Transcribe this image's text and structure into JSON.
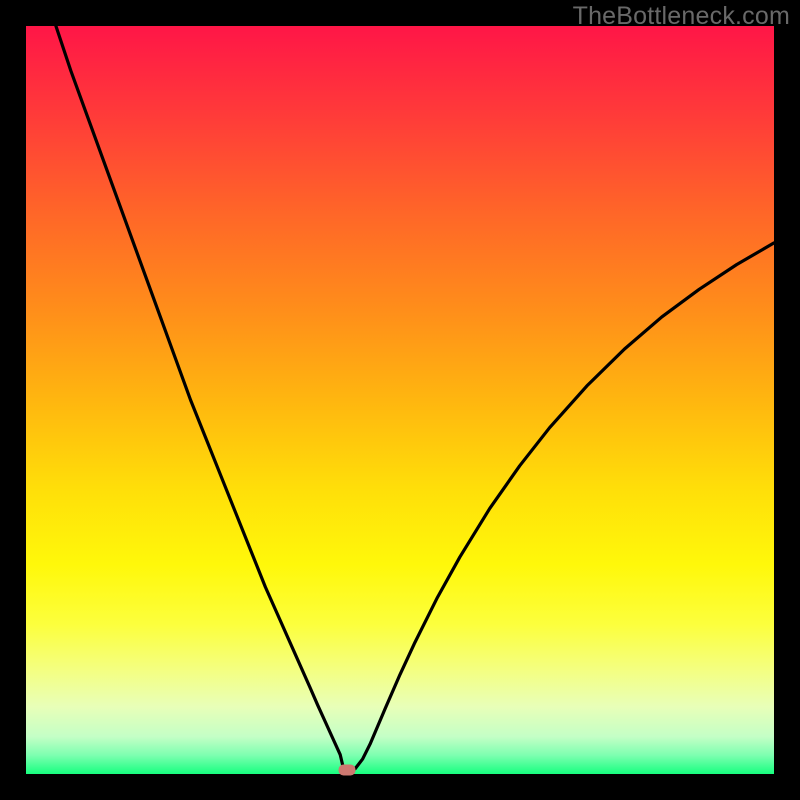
{
  "watermark": "TheBottleneck.com",
  "chart_data": {
    "type": "line",
    "title": "",
    "xlabel": "",
    "ylabel": "",
    "xlim": [
      0,
      100
    ],
    "ylim": [
      0,
      100
    ],
    "grid": false,
    "legend": false,
    "colors": {
      "gradient_stops": [
        {
          "pct": 0,
          "hex": "#ff1647"
        },
        {
          "pct": 12,
          "hex": "#ff3b39"
        },
        {
          "pct": 25,
          "hex": "#ff6628"
        },
        {
          "pct": 38,
          "hex": "#ff8e1a"
        },
        {
          "pct": 50,
          "hex": "#ffb60f"
        },
        {
          "pct": 62,
          "hex": "#ffdf09"
        },
        {
          "pct": 72,
          "hex": "#fff80a"
        },
        {
          "pct": 80,
          "hex": "#fcff3d"
        },
        {
          "pct": 86,
          "hex": "#f4ff80"
        },
        {
          "pct": 91,
          "hex": "#e8ffb8"
        },
        {
          "pct": 95,
          "hex": "#c4ffc6"
        },
        {
          "pct": 97.5,
          "hex": "#7dffb0"
        },
        {
          "pct": 100,
          "hex": "#17ff7f"
        }
      ],
      "curve_stroke": "#000000",
      "marker_fill": "#cd7870"
    },
    "optimum_x": 42.5,
    "series": [
      {
        "name": "bottleneck-curve",
        "x": [
          4,
          6,
          8,
          10,
          12,
          14,
          16,
          18,
          20,
          22,
          24,
          26,
          28,
          30,
          32,
          34,
          36,
          38,
          39,
          40,
          41,
          42,
          42.5,
          43,
          44,
          45,
          46,
          48,
          50,
          52,
          55,
          58,
          62,
          66,
          70,
          75,
          80,
          85,
          90,
          95,
          100
        ],
        "values": [
          100,
          94,
          88.5,
          83,
          77.5,
          72,
          66.5,
          61,
          55.5,
          50,
          45,
          40,
          35,
          30,
          25,
          20.5,
          16,
          11.5,
          9.2,
          7,
          4.8,
          2.6,
          0.5,
          0.5,
          0.7,
          2.0,
          4.0,
          8.7,
          13.3,
          17.6,
          23.6,
          29.0,
          35.5,
          41.2,
          46.3,
          51.9,
          56.8,
          61.1,
          64.8,
          68.1,
          71.0
        ]
      }
    ],
    "marker": {
      "x": 42.9,
      "y": 0.5
    }
  }
}
